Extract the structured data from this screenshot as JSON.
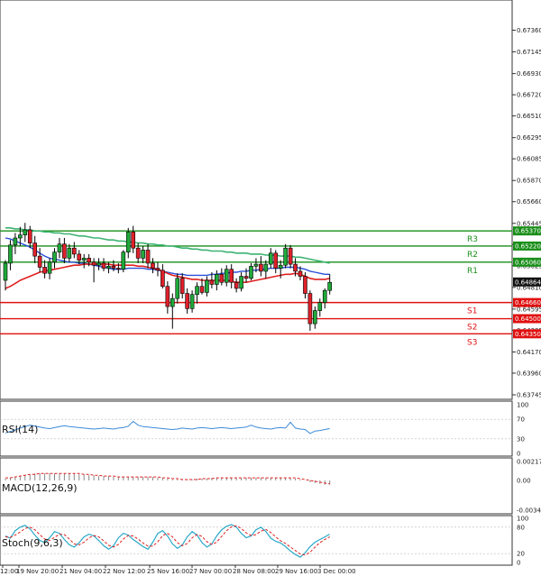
{
  "chart_data": {
    "type": "candlestick",
    "price_axis_labels": [
      "0.67360",
      "0.67145",
      "0.66930",
      "0.66720",
      "0.66510",
      "0.66295",
      "0.66085",
      "0.65870",
      "0.65660",
      "0.65445",
      "0.65235",
      "0.65025",
      "0.64810",
      "0.64595",
      "0.64385",
      "0.64170",
      "0.63960",
      "0.63745"
    ],
    "ylim": [
      0.63745,
      0.6757
    ],
    "time_labels": [
      "12:00",
      "19 Nov 20:00",
      "21 Nov 04:00",
      "22 Nov 12:00",
      "25 Nov 16:00",
      "27 Nov 00:00",
      "28 Nov 08:00",
      "29 Nov 16:00",
      "3 Dec 00:00"
    ],
    "current_price": "0.64864",
    "levels": [
      {
        "name": "R3",
        "value": "0.65370",
        "price": 0.6537,
        "color": "#1a8f1a"
      },
      {
        "name": "R2",
        "value": "0.65220",
        "price": 0.6522,
        "color": "#1a8f1a"
      },
      {
        "name": "R1",
        "value": "0.65060",
        "price": 0.6506,
        "color": "#1a8f1a"
      },
      {
        "name": "S1",
        "value": "0.64660",
        "price": 0.6466,
        "color": "#e01010"
      },
      {
        "name": "S2",
        "value": "0.64500",
        "price": 0.645,
        "color": "#e01010"
      },
      {
        "name": "S3",
        "value": "0.64350",
        "price": 0.6435,
        "color": "#e01010"
      }
    ],
    "candles": [
      [
        0.6488,
        0.6508,
        0.6478,
        0.6505
      ],
      [
        0.6505,
        0.6528,
        0.6498,
        0.6523
      ],
      [
        0.6523,
        0.6535,
        0.6514,
        0.653
      ],
      [
        0.653,
        0.6541,
        0.6522,
        0.6533
      ],
      [
        0.6533,
        0.6545,
        0.6526,
        0.6538
      ],
      [
        0.6538,
        0.6542,
        0.652,
        0.6525
      ],
      [
        0.6525,
        0.6532,
        0.6505,
        0.6512
      ],
      [
        0.6512,
        0.652,
        0.6496,
        0.6501
      ],
      [
        0.6501,
        0.6508,
        0.649,
        0.6495
      ],
      [
        0.6495,
        0.651,
        0.6489,
        0.6506
      ],
      [
        0.6506,
        0.652,
        0.65,
        0.6516
      ],
      [
        0.6516,
        0.653,
        0.651,
        0.6524
      ],
      [
        0.6524,
        0.653,
        0.6505,
        0.651
      ],
      [
        0.651,
        0.6524,
        0.6506,
        0.652
      ],
      [
        0.652,
        0.6526,
        0.651,
        0.6514
      ],
      [
        0.6514,
        0.6518,
        0.6504,
        0.6508
      ],
      [
        0.6508,
        0.6514,
        0.65,
        0.651
      ],
      [
        0.651,
        0.6514,
        0.6502,
        0.6506
      ],
      [
        0.6506,
        0.651,
        0.6486,
        0.6503
      ],
      [
        0.6503,
        0.651,
        0.6498,
        0.6505
      ],
      [
        0.6505,
        0.651,
        0.6497,
        0.65
      ],
      [
        0.65,
        0.6506,
        0.6495,
        0.6502
      ],
      [
        0.6502,
        0.6508,
        0.6497,
        0.65
      ],
      [
        0.65,
        0.6505,
        0.6495,
        0.6499
      ],
      [
        0.6499,
        0.6518,
        0.6496,
        0.6516
      ],
      [
        0.6516,
        0.654,
        0.651,
        0.6536
      ],
      [
        0.6536,
        0.6542,
        0.6515,
        0.652
      ],
      [
        0.652,
        0.6525,
        0.6505,
        0.651
      ],
      [
        0.651,
        0.6522,
        0.6505,
        0.6518
      ],
      [
        0.6518,
        0.6524,
        0.65,
        0.6505
      ],
      [
        0.6505,
        0.651,
        0.6495,
        0.65
      ],
      [
        0.65,
        0.6506,
        0.6492,
        0.6498
      ],
      [
        0.6498,
        0.6504,
        0.648,
        0.6482
      ],
      [
        0.6482,
        0.6487,
        0.6455,
        0.6462
      ],
      [
        0.6462,
        0.6475,
        0.644,
        0.647
      ],
      [
        0.647,
        0.6495,
        0.6465,
        0.649
      ],
      [
        0.649,
        0.6495,
        0.647,
        0.6475
      ],
      [
        0.6475,
        0.648,
        0.6455,
        0.646
      ],
      [
        0.646,
        0.6478,
        0.6456,
        0.6474
      ],
      [
        0.6474,
        0.6486,
        0.6465,
        0.6482
      ],
      [
        0.6482,
        0.649,
        0.6474,
        0.6476
      ],
      [
        0.6476,
        0.6492,
        0.6472,
        0.6488
      ],
      [
        0.6488,
        0.6496,
        0.648,
        0.6484
      ],
      [
        0.6484,
        0.6498,
        0.6478,
        0.6494
      ],
      [
        0.6494,
        0.65,
        0.6483,
        0.6486
      ],
      [
        0.6486,
        0.6503,
        0.6482,
        0.6499
      ],
      [
        0.6499,
        0.6504,
        0.648,
        0.6486
      ],
      [
        0.6486,
        0.649,
        0.6476,
        0.648
      ],
      [
        0.648,
        0.6496,
        0.6477,
        0.6492
      ],
      [
        0.6492,
        0.65,
        0.6486,
        0.649
      ],
      [
        0.649,
        0.6505,
        0.6488,
        0.6502
      ],
      [
        0.6502,
        0.651,
        0.6496,
        0.6504
      ],
      [
        0.6504,
        0.6512,
        0.6492,
        0.6497
      ],
      [
        0.6497,
        0.6508,
        0.649,
        0.6504
      ],
      [
        0.6504,
        0.652,
        0.65,
        0.6515
      ],
      [
        0.6515,
        0.6518,
        0.6495,
        0.65
      ],
      [
        0.65,
        0.6508,
        0.649,
        0.6503
      ],
      [
        0.6503,
        0.6524,
        0.65,
        0.652
      ],
      [
        0.652,
        0.6523,
        0.65,
        0.6504
      ],
      [
        0.6504,
        0.651,
        0.6492,
        0.6497
      ],
      [
        0.6497,
        0.6502,
        0.6488,
        0.6492
      ],
      [
        0.6492,
        0.6496,
        0.647,
        0.6475
      ],
      [
        0.6475,
        0.6478,
        0.6438,
        0.6445
      ],
      [
        0.6445,
        0.6462,
        0.644,
        0.6458
      ],
      [
        0.6458,
        0.647,
        0.6452,
        0.6466
      ],
      [
        0.6466,
        0.648,
        0.646,
        0.6478
      ],
      [
        0.6478,
        0.6494,
        0.6474,
        0.6486
      ]
    ],
    "ma_green": [
      0.654,
      0.654,
      0.6539,
      0.6539,
      0.6538,
      0.6538,
      0.6537,
      0.6537,
      0.6536,
      0.6536,
      0.6535,
      0.6535,
      0.6534,
      0.6534,
      0.6533,
      0.6532,
      0.6532,
      0.6531,
      0.653,
      0.653,
      0.6529,
      0.6528,
      0.6528,
      0.6527,
      0.6527,
      0.6526,
      0.6526,
      0.6525,
      0.6525,
      0.6524,
      0.6524,
      0.6523,
      0.6523,
      0.6522,
      0.6522,
      0.6521,
      0.652,
      0.652,
      0.6519,
      0.6519,
      0.6518,
      0.6518,
      0.6517,
      0.6517,
      0.6517,
      0.6516,
      0.6516,
      0.6515,
      0.6515,
      0.6515,
      0.6514,
      0.6514,
      0.6514,
      0.6513,
      0.6513,
      0.6513,
      0.6512,
      0.6512,
      0.6512,
      0.6511,
      0.6511,
      0.651,
      0.6509,
      0.6508,
      0.6507,
      0.6506,
      0.6505
    ],
    "ma_blue": [
      0.653,
      0.6529,
      0.6527,
      0.6525,
      0.6523,
      0.6521,
      0.6518,
      0.6515,
      0.6512,
      0.651,
      0.6509,
      0.6508,
      0.6507,
      0.6506,
      0.6506,
      0.6505,
      0.6505,
      0.6504,
      0.6503,
      0.6502,
      0.6501,
      0.65,
      0.6499,
      0.6499,
      0.6499,
      0.65,
      0.65,
      0.65,
      0.65,
      0.6499,
      0.6499,
      0.6498,
      0.6497,
      0.6496,
      0.6495,
      0.6494,
      0.6494,
      0.6493,
      0.6493,
      0.6493,
      0.6493,
      0.6493,
      0.6494,
      0.6494,
      0.6495,
      0.6495,
      0.6496,
      0.6496,
      0.6497,
      0.6497,
      0.6498,
      0.6498,
      0.6499,
      0.6499,
      0.65,
      0.65,
      0.65,
      0.6501,
      0.6501,
      0.6501,
      0.65,
      0.6499,
      0.6497,
      0.6496,
      0.6495,
      0.6494,
      0.6494
    ],
    "ma_red": [
      0.648,
      0.6482,
      0.6485,
      0.6488,
      0.649,
      0.6492,
      0.6494,
      0.6496,
      0.6497,
      0.6498,
      0.6499,
      0.65,
      0.6501,
      0.6502,
      0.6503,
      0.6503,
      0.6504,
      0.6504,
      0.6504,
      0.6504,
      0.6504,
      0.6504,
      0.6503,
      0.6503,
      0.6503,
      0.6503,
      0.6503,
      0.6502,
      0.6502,
      0.6501,
      0.65,
      0.6499,
      0.6497,
      0.6495,
      0.6493,
      0.6492,
      0.6491,
      0.649,
      0.6489,
      0.6489,
      0.6488,
      0.6488,
      0.6488,
      0.6488,
      0.6488,
      0.6488,
      0.6487,
      0.6486,
      0.6486,
      0.6486,
      0.6487,
      0.6488,
      0.6489,
      0.649,
      0.6491,
      0.6492,
      0.6493,
      0.6494,
      0.6494,
      0.6495,
      0.6494,
      0.6492,
      0.649,
      0.6489,
      0.6489,
      0.6489,
      0.649
    ],
    "rsi": {
      "label": "RSI(14)",
      "ticks": [
        "100",
        "70",
        "30",
        "0"
      ],
      "ylim": [
        0,
        100
      ],
      "values": [
        42,
        45,
        48,
        52,
        55,
        58,
        56,
        54,
        52,
        51,
        53,
        55,
        57,
        55,
        54,
        53,
        52,
        51,
        50,
        51,
        52,
        51,
        50,
        52,
        53,
        56,
        66,
        58,
        55,
        54,
        53,
        52,
        51,
        50,
        49,
        50,
        52,
        51,
        50,
        52,
        53,
        52,
        51,
        52,
        53,
        52,
        51,
        52,
        53,
        54,
        58,
        54,
        52,
        51,
        50,
        52,
        53,
        52,
        64,
        52,
        50,
        49,
        41,
        46,
        47,
        49,
        51
      ]
    },
    "macd": {
      "label": "MACD(12,26,9)",
      "ticks": [
        "0.002171",
        "0.00",
        "-0.00342"
      ],
      "ylim": [
        -0.00342,
        0.002171
      ],
      "histogram": [
        0.0002,
        0.0003,
        0.0004,
        0.0005,
        0.0006,
        0.0007,
        0.0008,
        0.0008,
        0.0008,
        0.0008,
        0.0008,
        0.0008,
        0.0008,
        0.0008,
        0.0008,
        0.0007,
        0.0007,
        0.0006,
        0.0006,
        0.0005,
        0.0005,
        0.0005,
        0.0004,
        0.0004,
        0.0004,
        0.0004,
        0.0004,
        0.0004,
        0.0004,
        0.0004,
        0.0004,
        0.0003,
        0.0003,
        0.0002,
        0.0001,
        0.0001,
        0.0001,
        0.0001,
        0.0001,
        0.0002,
        0.0002,
        0.0002,
        0.0003,
        0.0003,
        0.0003,
        0.0003,
        0.0003,
        0.0003,
        0.0003,
        0.0003,
        0.0003,
        0.0003,
        0.0003,
        0.0003,
        0.0003,
        0.0003,
        0.0003,
        0.0003,
        0.0003,
        0.0002,
        0.0001,
        0.0,
        -0.0002,
        -0.0003,
        -0.0004,
        -0.0005,
        -0.0005
      ],
      "signal": [
        0.0003,
        0.0003,
        0.0004,
        0.0005,
        0.0006,
        0.0007,
        0.0007,
        0.0008,
        0.0008,
        0.0008,
        0.0008,
        0.0008,
        0.0008,
        0.0008,
        0.0008,
        0.0008,
        0.0007,
        0.0007,
        0.0006,
        0.0006,
        0.0005,
        0.0005,
        0.0005,
        0.0004,
        0.0004,
        0.0004,
        0.0004,
        0.0004,
        0.0004,
        0.0004,
        0.0004,
        0.0004,
        0.0003,
        0.0003,
        0.0002,
        0.0002,
        0.0001,
        0.0001,
        0.0001,
        0.0001,
        0.0002,
        0.0002,
        0.0002,
        0.0003,
        0.0003,
        0.0003,
        0.0003,
        0.0003,
        0.0003,
        0.0003,
        0.0003,
        0.0003,
        0.0003,
        0.0003,
        0.0003,
        0.0003,
        0.0003,
        0.0003,
        0.0003,
        0.0003,
        0.0002,
        0.0001,
        0.0,
        -0.0001,
        -0.0002,
        -0.0003,
        -0.0004
      ]
    },
    "stoch": {
      "label": "Stoch(9,6,3)",
      "ticks": [
        "100",
        "80",
        "20",
        "0"
      ],
      "ylim": [
        0,
        100
      ],
      "k": [
        60,
        55,
        72,
        80,
        84,
        76,
        62,
        50,
        45,
        56,
        70,
        66,
        52,
        40,
        35,
        45,
        58,
        64,
        60,
        50,
        38,
        30,
        38,
        56,
        66,
        62,
        52,
        44,
        36,
        30,
        46,
        66,
        72,
        60,
        42,
        32,
        40,
        58,
        70,
        62,
        45,
        35,
        42,
        60,
        74,
        82,
        86,
        80,
        66,
        56,
        60,
        74,
        80,
        70,
        55,
        48,
        44,
        36,
        26,
        18,
        12,
        22,
        36,
        46,
        52,
        58,
        64
      ],
      "d": [
        58,
        57,
        62,
        69,
        77,
        80,
        74,
        63,
        53,
        50,
        57,
        64,
        63,
        53,
        42,
        40,
        46,
        56,
        61,
        58,
        49,
        39,
        35,
        41,
        53,
        61,
        60,
        53,
        44,
        37,
        37,
        47,
        61,
        66,
        58,
        45,
        38,
        43,
        56,
        63,
        59,
        47,
        41,
        46,
        59,
        72,
        81,
        83,
        77,
        67,
        61,
        63,
        71,
        75,
        68,
        58,
        49,
        43,
        35,
        27,
        19,
        17,
        23,
        35,
        45,
        52,
        58
      ]
    }
  }
}
